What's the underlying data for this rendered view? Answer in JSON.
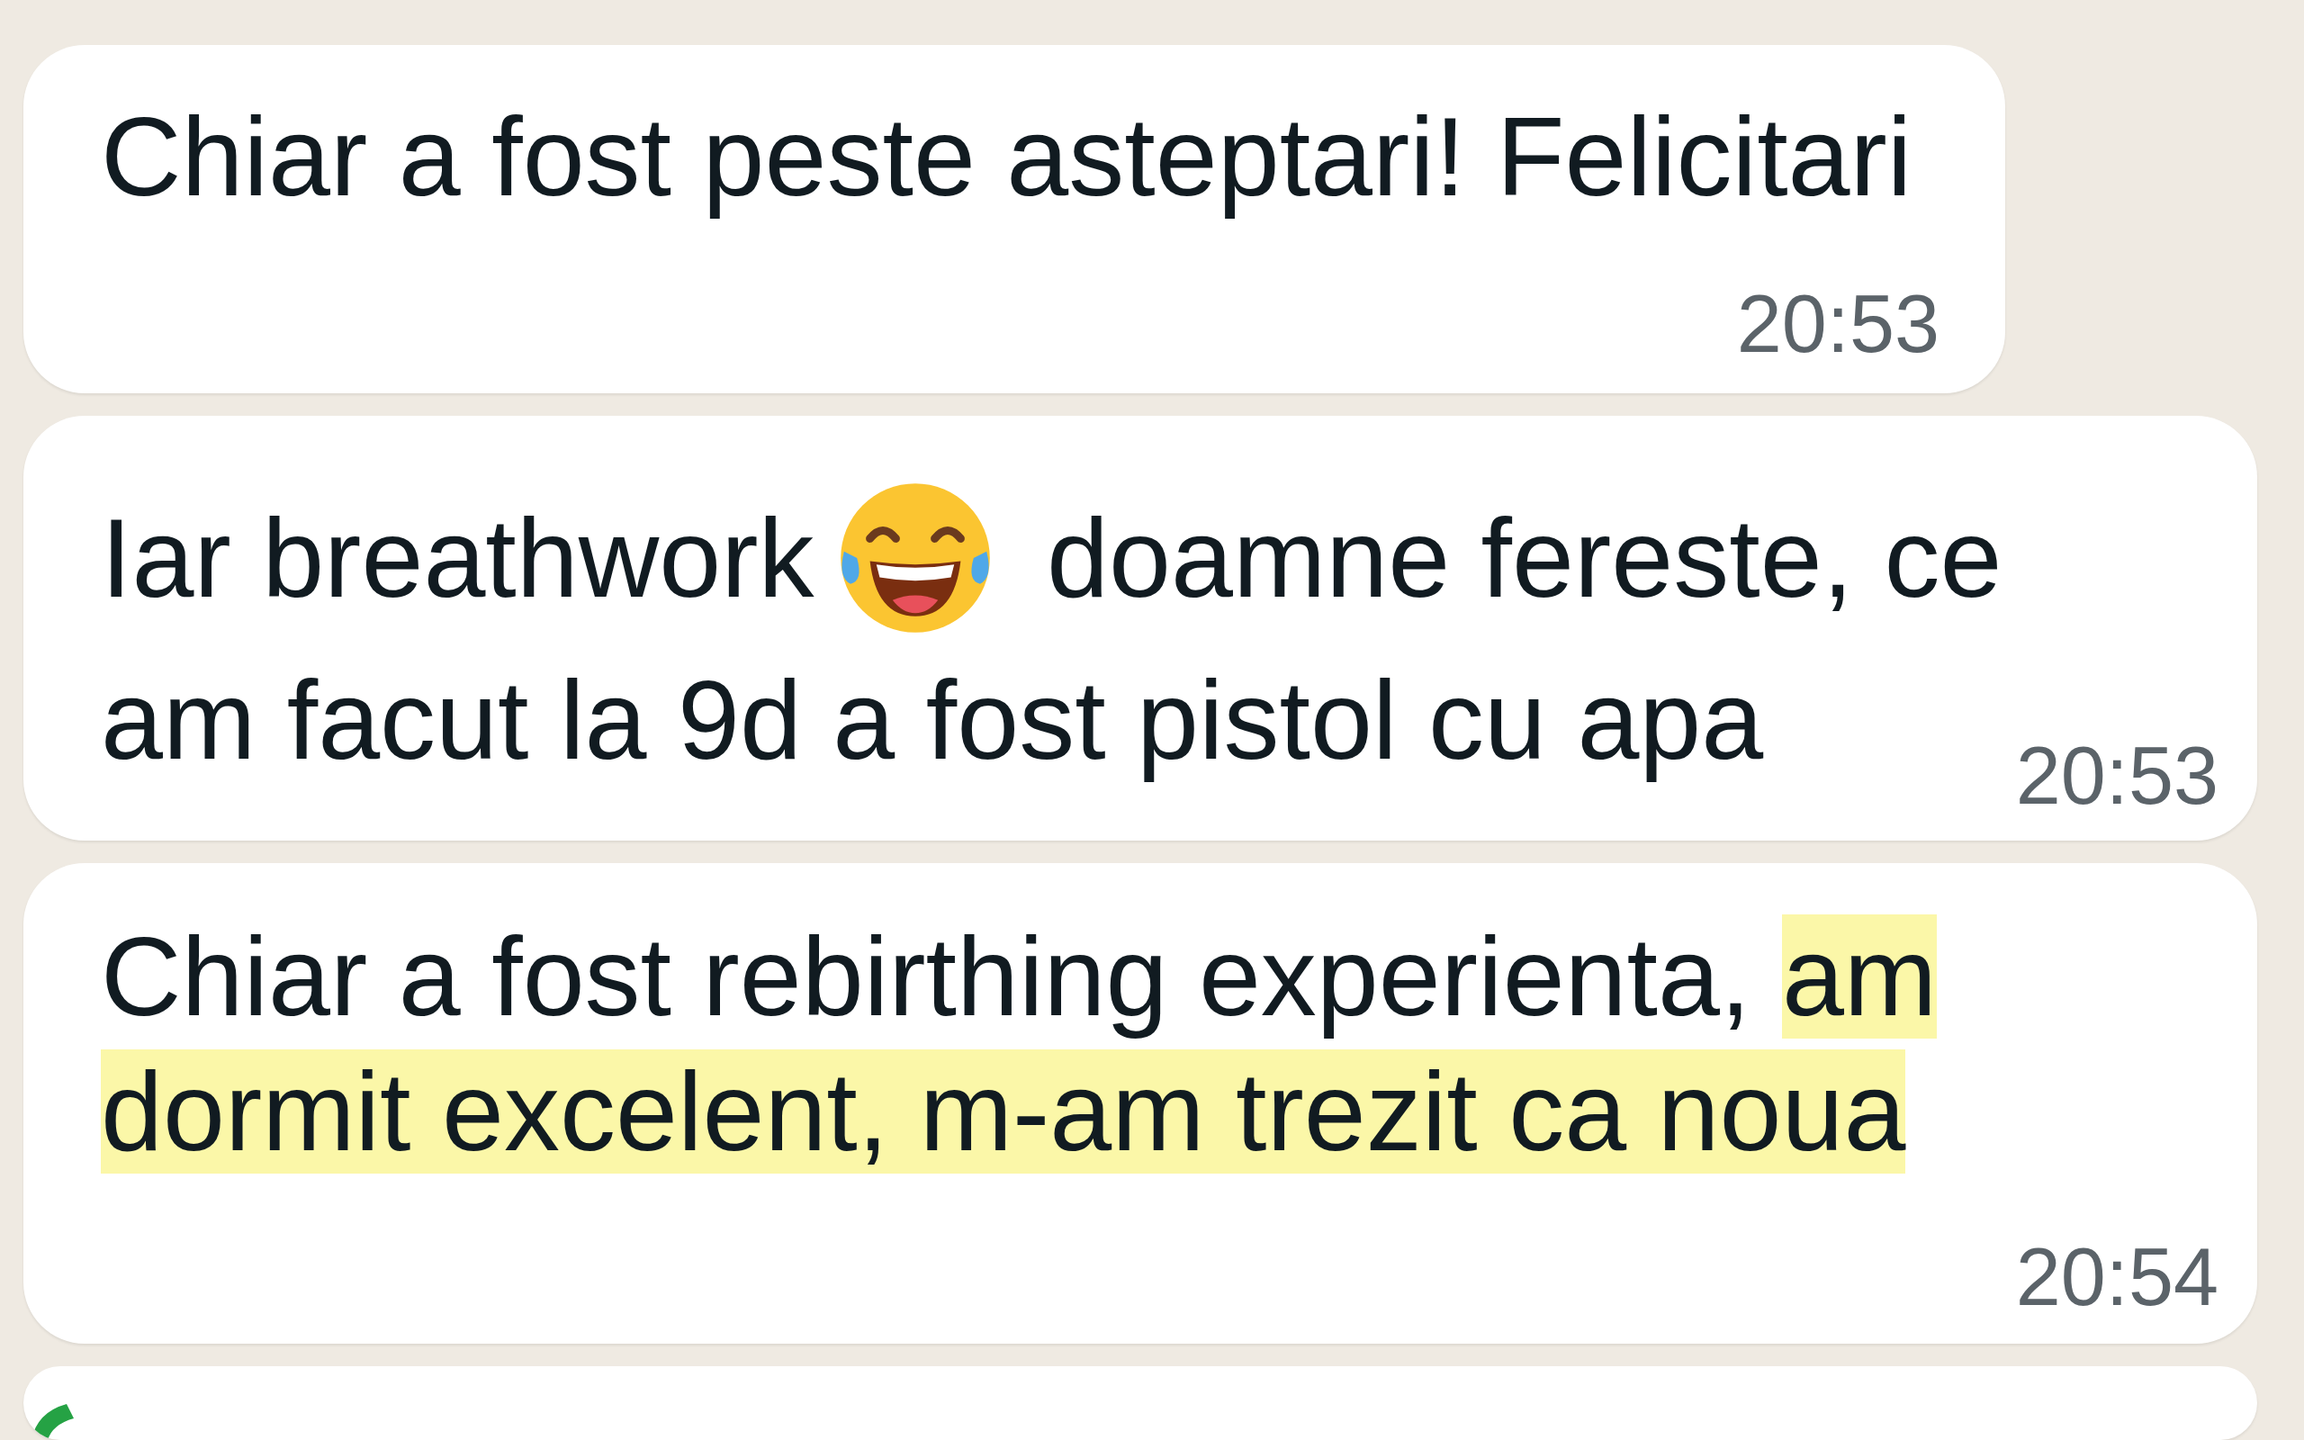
{
  "messages": [
    {
      "time": "20:53",
      "lines": [
        [
          {
            "kind": "text",
            "text": "Chiar a fost peste asteptari! Felicitari",
            "highlighted": false
          }
        ]
      ]
    },
    {
      "time": "20:53",
      "lines": [
        [
          {
            "kind": "text",
            "text": "Iar breathwork",
            "highlighted": false
          },
          {
            "kind": "emoji"
          },
          {
            "kind": "text",
            "text": "doamne fereste, ce",
            "highlighted": false
          }
        ],
        [
          {
            "kind": "text",
            "text": "am facut la 9d a fost pistol cu apa",
            "highlighted": false
          }
        ]
      ]
    },
    {
      "time": "20:54",
      "lines": [
        [
          {
            "kind": "text",
            "text": "Chiar a fost rebirthing experienta,",
            "highlighted": false
          },
          {
            "kind": "text",
            "text": "am",
            "highlighted": true
          }
        ],
        [
          {
            "kind": "text",
            "text": "dormit excelent, m-am trezit ca noua",
            "highlighted": true
          }
        ]
      ]
    }
  ],
  "next_message": {
    "kind": "partial"
  }
}
